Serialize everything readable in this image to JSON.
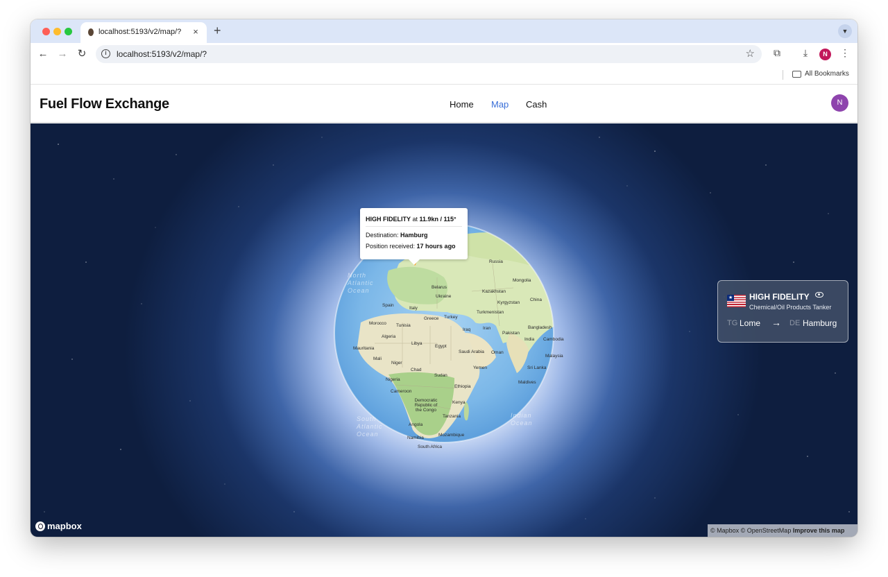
{
  "browser": {
    "tab_title": "localhost:5193/v2/map/?",
    "tab_close": "×",
    "new_tab": "+",
    "url": "localhost:5193/v2/map/?",
    "bookmarks_label": "All Bookmarks",
    "profile_initial": "N"
  },
  "app": {
    "brand": "Fuel Flow Exchange",
    "nav": {
      "home": "Home",
      "map": "Map",
      "cash": "Cash"
    },
    "active_nav": "Map",
    "avatar_initial": "N",
    "accent_color": "#3a6fd8",
    "avatar_color": "#8e44ad"
  },
  "map": {
    "popup": {
      "vessel": "HIGH FIDELITY",
      "at_word": " at ",
      "speed_course": "11.9kn / 115°",
      "destination_label": "Destination: ",
      "destination": "Hamburg",
      "position_label": "Position received: ",
      "position_age": "17 hours ago"
    },
    "labels": {
      "russia": "Russia",
      "mongolia": "Mongolia",
      "belarus": "Belarus",
      "ukraine": "Ukraine",
      "kazakhstan": "Kazakhstan",
      "kyrgyzstan": "Kyrgyzstan",
      "china": "China",
      "spain": "Spain",
      "italy": "Italy",
      "greece": "Greece",
      "turkey": "Turkey",
      "turkmenistan": "Turkmenistan",
      "morocco": "Morocco",
      "tunisia": "Tunisia",
      "iraq": "Iraq",
      "iran": "Iran",
      "bangladesh": "Bangladesh",
      "pakistan": "Pakistan",
      "algeria": "Algeria",
      "libya": "Libya",
      "egypt": "Egypt",
      "india": "India",
      "cambodia": "Cambodia",
      "mauritania": "Mauritania",
      "saudi": "Saudi Arabia",
      "oman": "Oman",
      "malaysia": "Malaysia",
      "mali": "Mali",
      "niger": "Niger",
      "chad": "Chad",
      "yemen": "Yemen",
      "srilanka": "Sri Lanka",
      "sudan": "Sudan",
      "nigeria": "Nigeria",
      "ethiopia": "Ethiopia",
      "maldives": "Maldives",
      "cameroon": "Cameroon",
      "drc": "Democratic Republic of the Congo",
      "kenya": "Kenya",
      "tanzania": "Tanzania",
      "angola": "Angola",
      "namibia": "Namibia",
      "mozambique": "Mozambique",
      "southafrica": "South Africa"
    },
    "oceans": {
      "north_atlantic": "North Atlantic Ocean",
      "south_atlantic": "South Atlantic Ocean",
      "indian": "Indian Ocean"
    },
    "vessel_card": {
      "name": "HIGH FIDELITY",
      "type": "Chemical/Oil Products Tanker",
      "from_cc": "TG",
      "from": "Lome",
      "arrow": "→",
      "to_cc": "DE",
      "to": "Hamburg",
      "flag": "liberia-flag",
      "marker_color": "#ff8a00"
    },
    "logo_text": "mapbox",
    "attribution": {
      "text": "© Mapbox © OpenStreetMap ",
      "improve": "Improve this map"
    }
  }
}
